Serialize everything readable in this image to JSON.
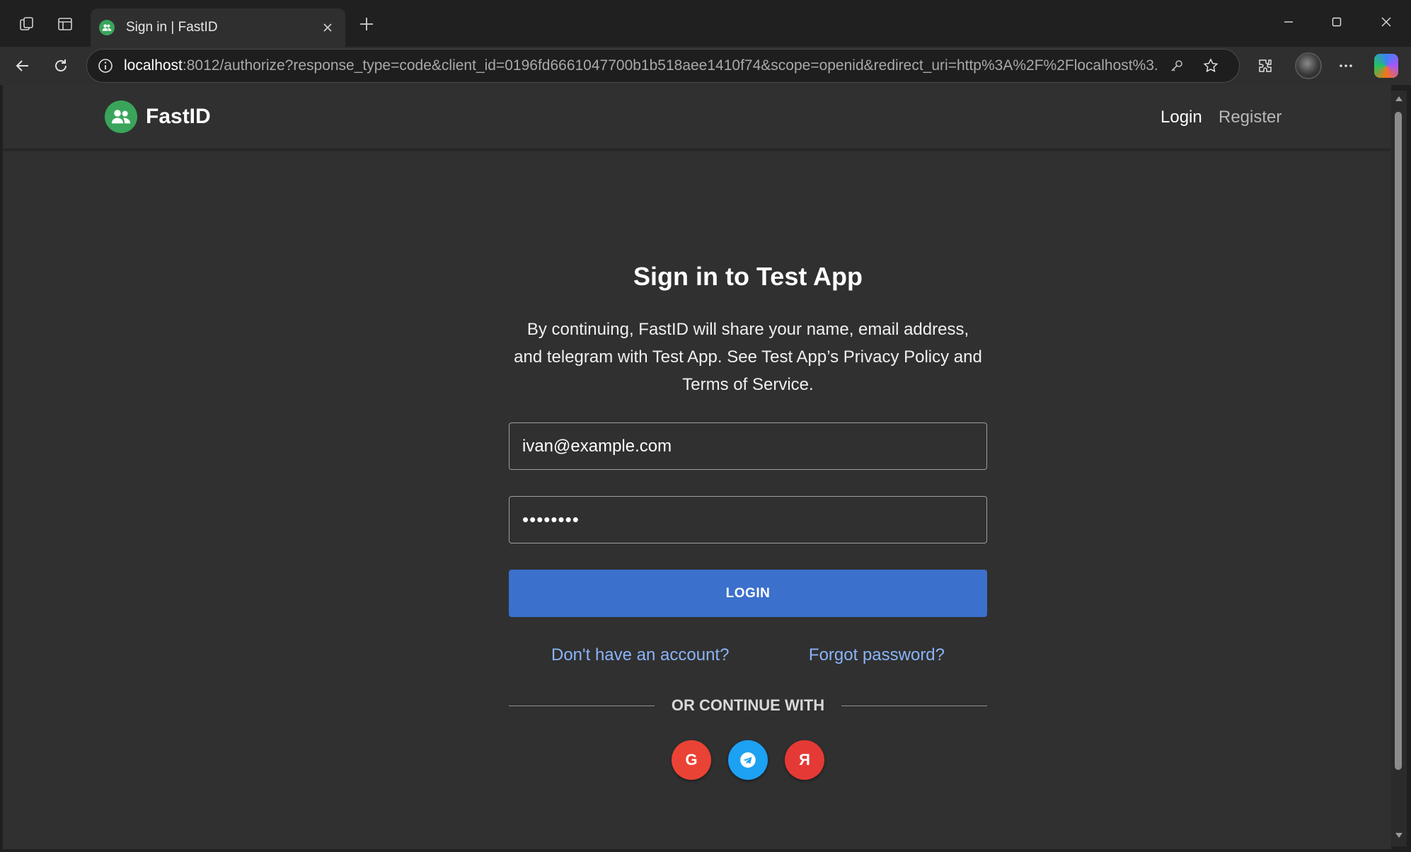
{
  "browser": {
    "tab_title": "Sign in | FastID",
    "url_host": "localhost",
    "url_rest": ":8012/authorize?response_type=code&client_id=0196fd6661047700b1b518aee1410f74&scope=openid&redirect_uri=http%3A%2F%2Flocalhost%3..."
  },
  "navbar": {
    "brand": "FastID",
    "login_label": "Login",
    "register_label": "Register"
  },
  "form": {
    "title": "Sign in to Test App",
    "description": "By continuing, FastID will share your name, email address, and telegram with Test App. See Test App’s Privacy Policy and Terms of Service.",
    "email_value": "ivan@example.com",
    "password_value": "••••••••",
    "login_button": "LOGIN",
    "signup_link": "Don't have an account?",
    "forgot_link": "Forgot password?",
    "divider_text": "OR CONTINUE WITH",
    "social": [
      {
        "name": "google",
        "glyph": "G",
        "color": "#ea4335"
      },
      {
        "name": "telegram",
        "glyph": "",
        "color": "#1da1f2"
      },
      {
        "name": "yandex",
        "glyph": "Я",
        "color": "#e53935"
      }
    ]
  },
  "colors": {
    "accent": "#3b70cc",
    "link": "#8ab4f8",
    "brand_green": "#3aa55a"
  }
}
